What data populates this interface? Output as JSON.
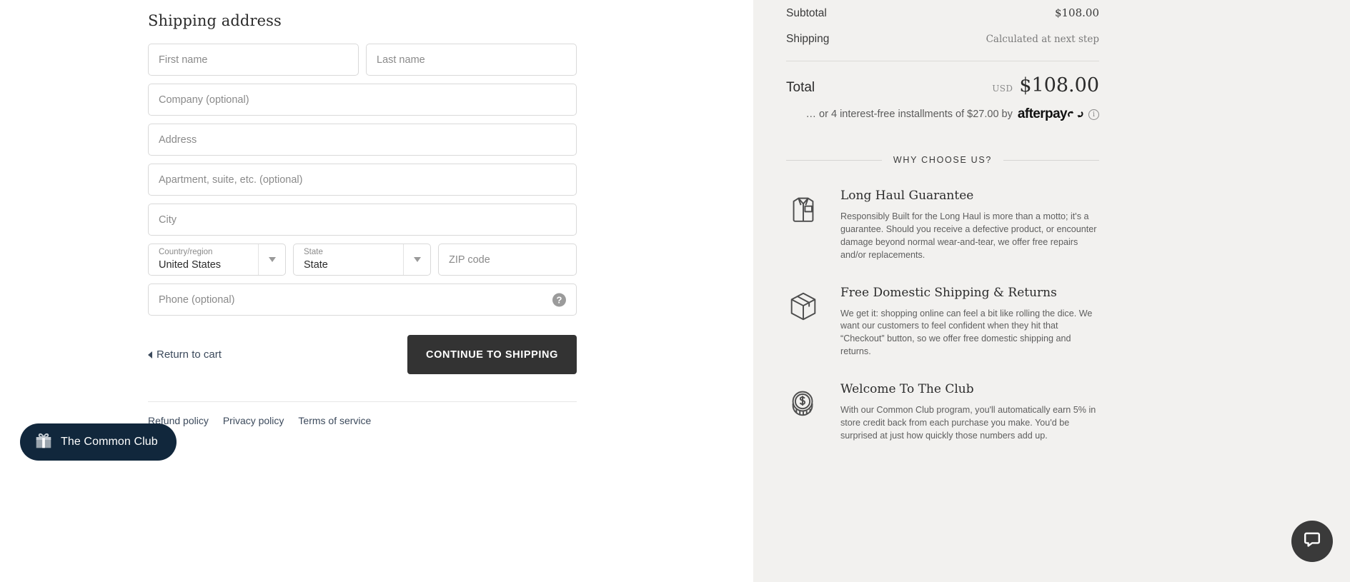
{
  "shipping": {
    "title": "Shipping address",
    "fields": {
      "first_name": "First name",
      "last_name": "Last name",
      "company": "Company (optional)",
      "address": "Address",
      "apartment": "Apartment, suite, etc. (optional)",
      "city": "City",
      "zip": "ZIP code",
      "phone": "Phone (optional)"
    },
    "country": {
      "label": "Country/region",
      "value": "United States"
    },
    "state": {
      "label": "State",
      "value": "State"
    },
    "help_icon": "question-mark-icon"
  },
  "actions": {
    "return_to_cart": "Return to cart",
    "continue": "CONTINUE TO SHIPPING"
  },
  "footer": {
    "links": [
      "Refund policy",
      "Privacy policy",
      "Terms of service"
    ]
  },
  "club_widget": {
    "label": "The Common Club",
    "icon": "gift-icon",
    "bg_color": "#11273c"
  },
  "summary": {
    "rows": [
      {
        "label": "Subtotal",
        "value": "$108.00",
        "muted": false
      },
      {
        "label": "Shipping",
        "value": "Calculated at next step",
        "muted": true
      }
    ],
    "total": {
      "label": "Total",
      "currency": "USD",
      "amount": "$108.00"
    },
    "afterpay": {
      "text": "… or 4 interest-free installments of $27.00 by",
      "logo": "afterpay",
      "info_icon": "info-icon"
    }
  },
  "why_choose_us": {
    "title": "WHY CHOOSE US?",
    "benefits": [
      {
        "icon": "folded-shirt-icon",
        "title": "Long Haul Guarantee",
        "text": "Responsibly Built for the Long Haul is more than a motto; it's a guarantee. Should you receive a defective product, or encounter damage beyond normal wear-and-tear, we offer free repairs and/or replacements."
      },
      {
        "icon": "package-box-icon",
        "title": "Free Domestic Shipping & Returns",
        "text": "We get it: shopping online can feel a bit like rolling the dice. We want our customers to feel confident when they hit that “Checkout” button, so we offer free domestic shipping and returns."
      },
      {
        "icon": "coin-dollar-icon",
        "title": "Welcome To The Club",
        "text": "With our Common Club program, you'll automatically earn 5% in store credit back from each purchase you make. You'd be surprised at just how quickly those numbers add up."
      }
    ]
  },
  "chat": {
    "icon": "chat-bubble-icon",
    "bg_color": "#3a3a3a"
  }
}
